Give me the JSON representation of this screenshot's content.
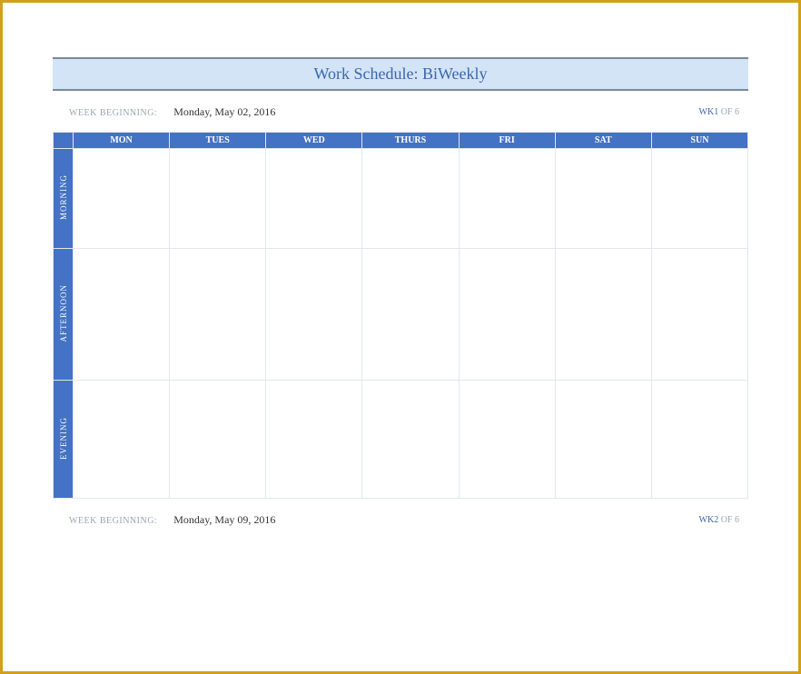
{
  "title": "Work Schedule: BiWeekly",
  "week1": {
    "label": "WEEK BEGINNING:",
    "date": "Monday, May 02, 2016",
    "wk_prefix": "WK",
    "wk_num": "1",
    "wk_of": " OF ",
    "wk_total": "6"
  },
  "week2": {
    "label": "WEEK BEGINNING:",
    "date": "Monday, May 09, 2016",
    "wk_prefix": "WK",
    "wk_num": "2",
    "wk_of": " OF ",
    "wk_total": "6"
  },
  "days": {
    "mon": "MON",
    "tue": "TUES",
    "wed": "WED",
    "thu": "THURS",
    "fri": "FRI",
    "sat": "SAT",
    "sun": "SUN"
  },
  "periods": {
    "morning": "MORNING",
    "afternoon": "AFTERNOON",
    "evening": "EVENING"
  }
}
